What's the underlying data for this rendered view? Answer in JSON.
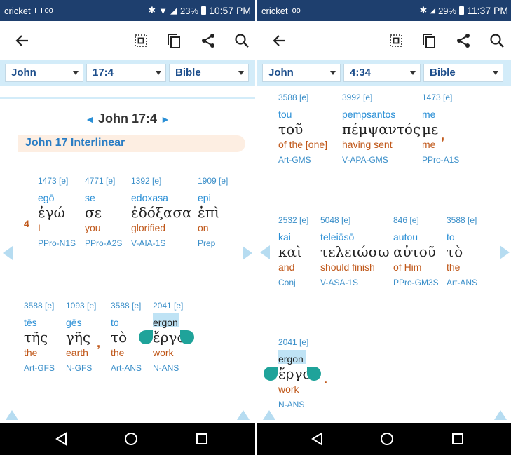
{
  "colors": {
    "statusbar": "#1e3f6e",
    "selector_bar": "#d3ecf9",
    "accent_blue": "#1e4f8c",
    "greek_text": "#222222",
    "english_orange": "#c0581a",
    "strongs_blue": "#3b8fc9",
    "handle_teal": "#1fa39a",
    "highlight": "#bfe3f5"
  },
  "left": {
    "status": {
      "carrier": "cricket",
      "battery": "23%",
      "time": "10:57 PM"
    },
    "selectors": {
      "book": "John",
      "reference": "17:4",
      "version": "Bible"
    },
    "reference_title": "John 17:4",
    "section_title": "John 17 Interlinear",
    "verse_number": "4",
    "words_row1": [
      {
        "strong": "1473 [e]",
        "translit": "egō",
        "greek": "ἐγώ",
        "english": "I",
        "morph": "PPro-N1S"
      },
      {
        "strong": "4771 [e]",
        "translit": "se",
        "greek": "σε",
        "english": "you",
        "morph": "PPro-A2S"
      },
      {
        "strong": "1392 [e]",
        "translit": "edoxasa",
        "greek": "ἐδόξασα",
        "english": "glorified",
        "morph": "V-AIA-1S"
      },
      {
        "strong": "1909 [e]",
        "translit": "epi",
        "greek": "ἐπὶ",
        "english": "on",
        "morph": "Prep"
      }
    ],
    "words_row2": [
      {
        "strong": "3588 [e]",
        "translit": "tēs",
        "greek": "τῆς",
        "english": "the",
        "morph": "Art-GFS"
      },
      {
        "strong": "1093 [e]",
        "translit": "gēs",
        "greek": "γῆς",
        "english": "earth",
        "morph": "N-GFS"
      },
      {
        "strong": "3588 [e]",
        "translit": "to",
        "greek": "τὸ",
        "english": "the",
        "morph": "Art-ANS"
      },
      {
        "strong": "2041 [e]",
        "translit": "ergon",
        "greek": "ἔργον",
        "english": "work",
        "morph": "N-ANS"
      }
    ],
    "punct_comma": ","
  },
  "right": {
    "status": {
      "carrier": "cricket",
      "battery": "29%",
      "time": "11:37 PM"
    },
    "selectors": {
      "book": "John",
      "reference": "4:34",
      "version": "Bible"
    },
    "words_row1": [
      {
        "strong": "3588 [e]",
        "translit": "tou",
        "greek": "τοῦ",
        "english": "of the [one]",
        "morph": "Art-GMS"
      },
      {
        "strong": "3992 [e]",
        "translit": "pempsantos",
        "greek": "πέμψαντός",
        "english": "having sent",
        "morph": "V-APA-GMS"
      },
      {
        "strong": "1473 [e]",
        "translit": "me",
        "greek": "με",
        "english": "me",
        "morph": "PPro-A1S"
      }
    ],
    "words_row2": [
      {
        "strong": "2532 [e]",
        "translit": "kai",
        "greek": "καὶ",
        "english": "and",
        "morph": "Conj"
      },
      {
        "strong": "5048 [e]",
        "translit": "teleiōsō",
        "greek": "τελειώσω",
        "english": "should finish",
        "morph": "V-ASA-1S"
      },
      {
        "strong": "846 [e]",
        "translit": "autou",
        "greek": "αὐτοῦ",
        "english": "of Him",
        "morph": "PPro-GM3S"
      },
      {
        "strong": "3588 [e]",
        "translit": "to",
        "greek": "τὸ",
        "english": "the",
        "morph": "Art-ANS"
      }
    ],
    "words_row3": [
      {
        "strong": "2041 [e]",
        "translit": "ergon",
        "greek": "ἔργον",
        "english": "work",
        "morph": "N-ANS"
      }
    ],
    "punct_comma": ",",
    "punct_period": "."
  }
}
